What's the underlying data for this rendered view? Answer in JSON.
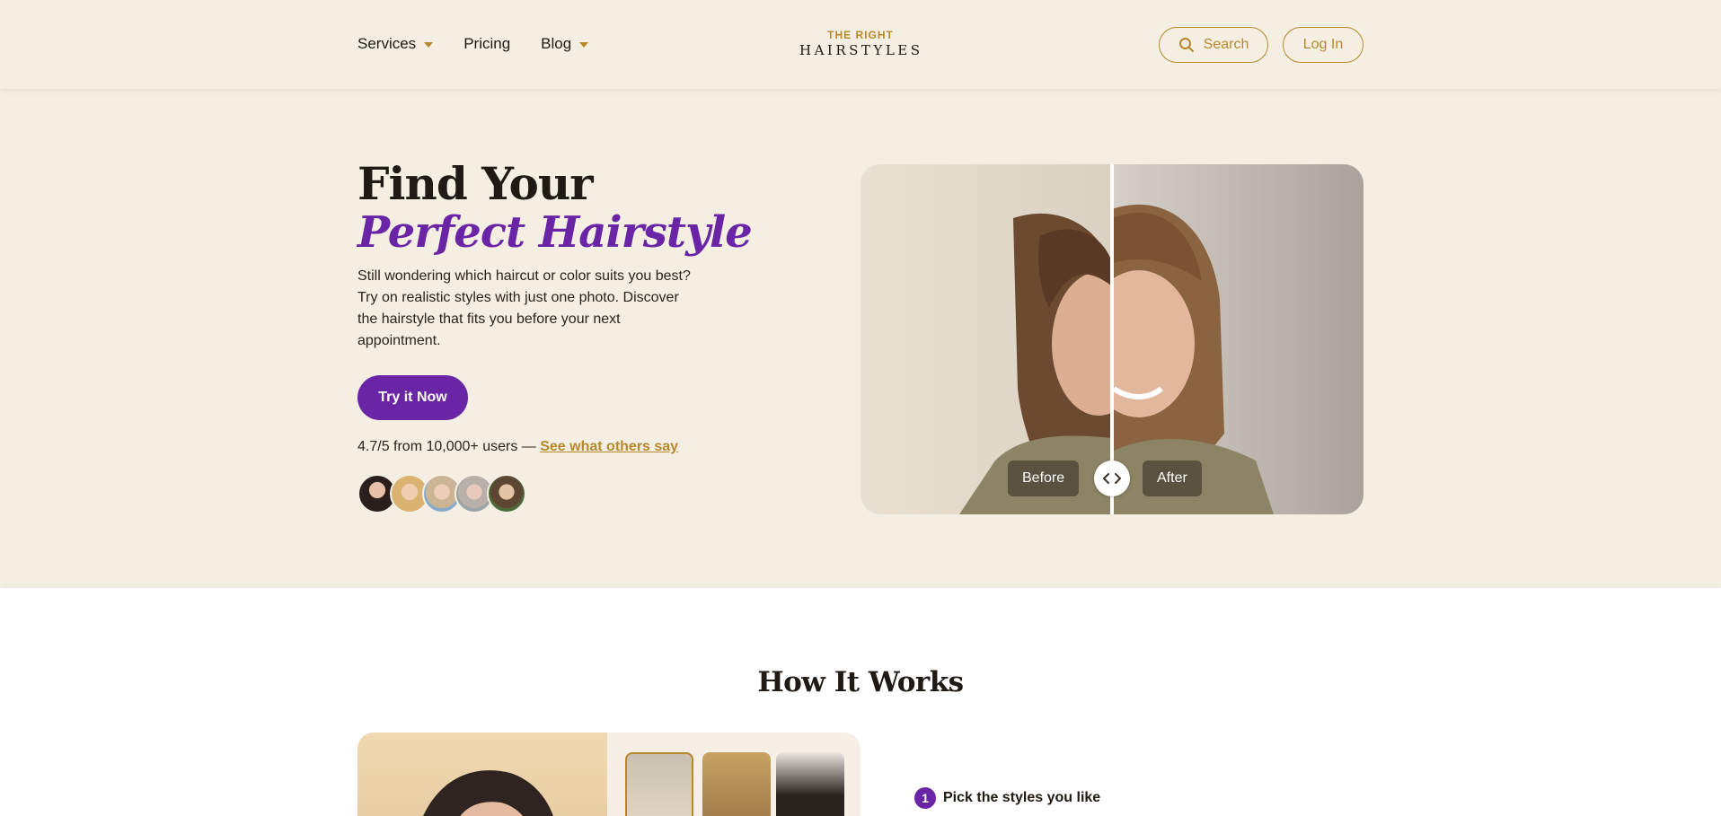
{
  "header": {
    "nav": [
      {
        "label": "Services"
      },
      {
        "label": "Pricing"
      },
      {
        "label": "Blog"
      }
    ],
    "logo": {
      "top": "THE RIGHT",
      "main": "HAIRSTYLES"
    },
    "search_label": "Search",
    "login_label": "Log In"
  },
  "hero": {
    "title_line1": "Find Your",
    "title_line2": "Perfect Hairstyle",
    "description": "Still wondering which haircut or color suits you best? Try on realistic styles with just one photo. Discover the hairstyle that fits you before your next appointment.",
    "cta_label": "Try it Now",
    "rating_text": "4.7/5 from 10,000+ users —",
    "rating_link": "See what others say",
    "compare": {
      "before_label": "Before",
      "after_label": "After"
    }
  },
  "how_it_works": {
    "title": "How It Works",
    "steps": [
      {
        "number": "1",
        "label": "Pick the styles you like"
      }
    ]
  },
  "colors": {
    "background": "#f4eee3",
    "accent_gold": "#b8892b",
    "accent_purple": "#6a24a6"
  }
}
